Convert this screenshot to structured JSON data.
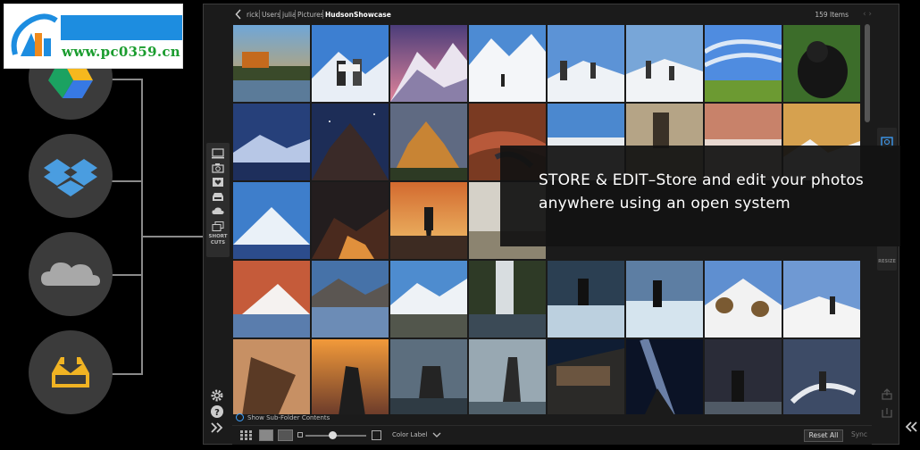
{
  "watermark": {
    "url": "www.pc0359.cn"
  },
  "cloud_services": [
    {
      "name": "google-drive-icon"
    },
    {
      "name": "dropbox-icon"
    },
    {
      "name": "onedrive-icon"
    },
    {
      "name": "local-drive-icon"
    }
  ],
  "app": {
    "breadcrumb": [
      "rick",
      "Users",
      "julia",
      "Pictures",
      "HudsonShowcase"
    ],
    "item_count": "159 Items",
    "left_rail": {
      "shortcuts_label_line1": "SHORT",
      "shortcuts_label_line2": "CUTS"
    },
    "right_rail": {
      "resize_label": "RESIZE"
    },
    "subfolder_label": "Show Sub-Folder Contents",
    "toolbar": {
      "color_label": "Color Label",
      "reset_label": "Reset All",
      "sync_label": "Sync"
    }
  },
  "overlay": {
    "text": "STORE & EDIT–Store and edit your photos anywhere using an open system"
  },
  "colors": {
    "accent": "#3ea2ff",
    "watermark_blue": "#1d8de0",
    "watermark_green": "#1a9c2e",
    "circle_bg": "#3b3b3b"
  }
}
